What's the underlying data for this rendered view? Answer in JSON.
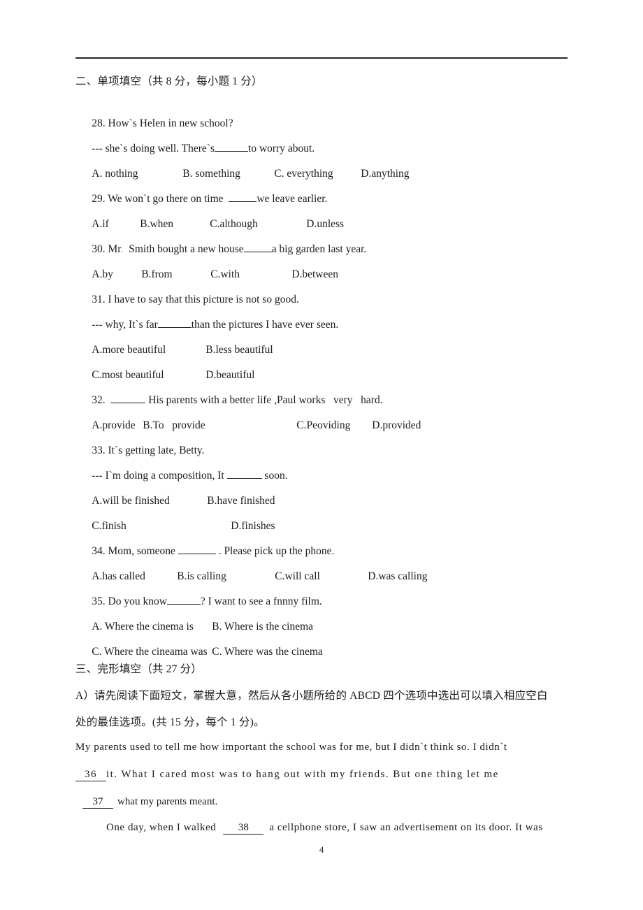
{
  "page": {
    "number": "4",
    "header_rule": true
  },
  "section_two": {
    "heading": "二、单项填空（共 8 分，每小题 1 分）",
    "questions": [
      {
        "id": "28",
        "stem": "28. How`s Helen in new school?",
        "response_before": "--- she`s doing well. There`s",
        "response_after": "to worry about.",
        "options": [
          "A. nothing",
          "B. something",
          "C. everything",
          "D.anything"
        ]
      },
      {
        "id": "29",
        "stem_before": "29. We won`t go there on time  ",
        "stem_after": "we leave earlier.",
        "options": [
          "A.if",
          "B.when",
          "C.although",
          "D.unless"
        ]
      },
      {
        "id": "30",
        "stem_before": "30. Mr",
        "stem_mark": ".",
        "stem_mid": "  Smith bought a new house",
        "stem_after": "a big garden last year.",
        "options": [
          "A.by",
          "B.from",
          "C.with",
          "D.between"
        ]
      },
      {
        "id": "31",
        "stem": "31. I have to say that this picture is not so good.",
        "response_before": "--- why, It`s far",
        "response_after": "than the pictures I have ever seen.",
        "options_row1": [
          "A.more beautiful",
          "B.less beautiful"
        ],
        "options_row2": [
          "C.most beautiful",
          "D.beautiful"
        ]
      },
      {
        "id": "32",
        "stem_before": "32.  ",
        "stem_after": " His parents with a better life ,Paul works   very   hard.",
        "options": [
          "A.provide",
          "B.To   provide",
          "C.Peoviding",
          "D.provided"
        ]
      },
      {
        "id": "33",
        "stem": "33. It`s getting late, Betty.",
        "response_before": "--- I`m doing a composition, It ",
        "response_after": " soon.",
        "options_row1": [
          "A.will be finished",
          "B.have finished"
        ],
        "options_row2": [
          "C.finish",
          "D.finishes"
        ]
      },
      {
        "id": "34",
        "stem_before": "34. Mom, someone ",
        "stem_after": " . Please pick up the phone.",
        "options": [
          "A.has called",
          "B.is calling",
          "C.will call",
          "D.was calling"
        ]
      },
      {
        "id": "35",
        "stem_before": "35. Do you know",
        "stem_after": "? I want to see a fnnny film.",
        "options_row1": [
          "A. Where the cinema is",
          "B. Where is the cinema"
        ],
        "options_row2": [
          "C. Where the cineama was",
          "C. Where was the cinema"
        ]
      }
    ]
  },
  "section_three": {
    "heading": "三、完形填空（共 27 分）",
    "instruction_line1": "A）请先阅读下面短文，掌握大意，然后从各小题所给的 ABCD 四个选项中选出可以填入相应空白",
    "instruction_line2": "处的最佳选项。(共 15 分，每个 1 分)。",
    "passage": {
      "p1_line1": "My parents used to tell me how important the school was for me, but I didn`t think so. I didn`t",
      "p1_line2_blank": "36",
      "p1_line2_text": "it. What I cared most was to hang out with my friends. But one thing let me",
      "p1_line3_blank": "37",
      "p1_line3_text": "what my parents meant.",
      "p2_line1_before": "One day, when I walked",
      "p2_line1_blank": "38",
      "p2_line1_after": "a cellphone store, I saw an advertisement on its door. It was"
    }
  },
  "colors": {
    "text": "#1c1c1c",
    "rule": "#262626",
    "mark": "#e8a33d"
  }
}
